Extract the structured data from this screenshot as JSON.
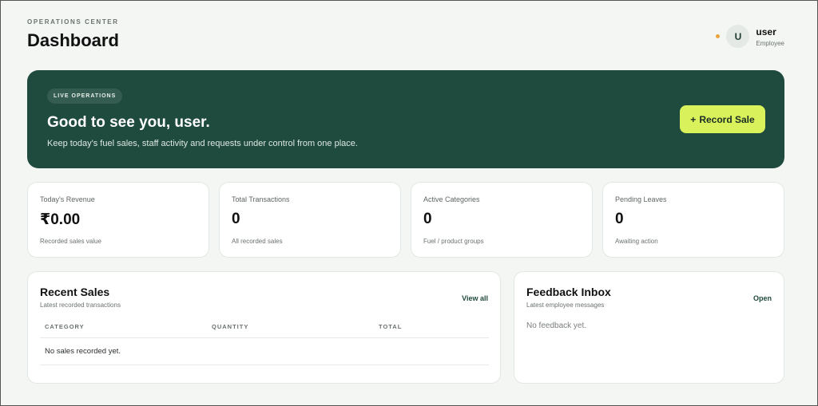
{
  "header": {
    "eyebrow": "OPERATIONS CENTER",
    "title": "Dashboard",
    "user": {
      "initial": "U",
      "name": "user",
      "role": "Employee"
    }
  },
  "hero": {
    "badge": "LIVE OPERATIONS",
    "title": "Good to see you, user.",
    "subtitle": "Keep today's fuel sales, staff activity and requests under control from one place.",
    "button_icon": "+",
    "button_label": "Record Sale"
  },
  "stats": [
    {
      "label": "Today's Revenue",
      "value": "₹0.00",
      "note": "Recorded sales value"
    },
    {
      "label": "Total Transactions",
      "value": "0",
      "note": "All recorded sales"
    },
    {
      "label": "Active Categories",
      "value": "0",
      "note": "Fuel / product groups"
    },
    {
      "label": "Pending Leaves",
      "value": "0",
      "note": "Awaiting action"
    }
  ],
  "recent_sales": {
    "title": "Recent Sales",
    "subtitle": "Latest recorded transactions",
    "link": "View all",
    "columns": [
      "CATEGORY",
      "QUANTITY",
      "TOTAL"
    ],
    "empty": "No sales recorded yet."
  },
  "feedback": {
    "title": "Feedback Inbox",
    "subtitle": "Latest employee messages",
    "link": "Open",
    "empty": "No feedback yet."
  },
  "colors": {
    "hero_bg": "#1f4a3e",
    "accent_button": "#d9f25c",
    "status_dot": "#e8a43a",
    "page_bg": "#f4f6f4"
  }
}
